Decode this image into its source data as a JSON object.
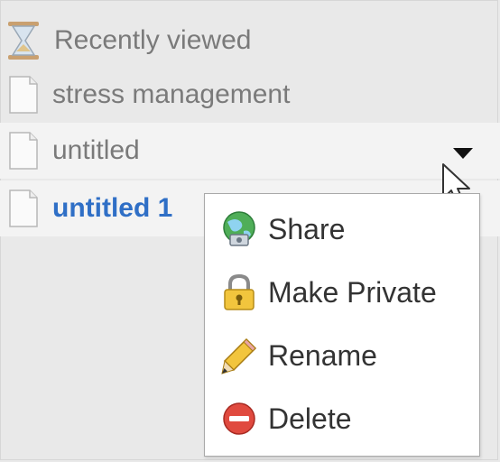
{
  "list": {
    "recently_viewed": {
      "label": "Recently viewed",
      "icon": "hourglass-icon"
    },
    "items": [
      {
        "label": "stress management",
        "icon": "document-icon"
      },
      {
        "label": "untitled",
        "icon": "document-icon"
      },
      {
        "label": "untitled 1",
        "icon": "document-icon",
        "selected": true
      }
    ]
  },
  "context_menu": {
    "items": [
      {
        "label": "Share",
        "icon": "share-globe-icon"
      },
      {
        "label": "Make Private",
        "icon": "lock-icon"
      },
      {
        "label": "Rename",
        "icon": "pencil-icon"
      },
      {
        "label": "Delete",
        "icon": "delete-icon"
      }
    ]
  },
  "colors": {
    "selected_text": "#2f6fc6",
    "muted_text": "#7a7a7a",
    "delete_red": "#e04a3f"
  }
}
